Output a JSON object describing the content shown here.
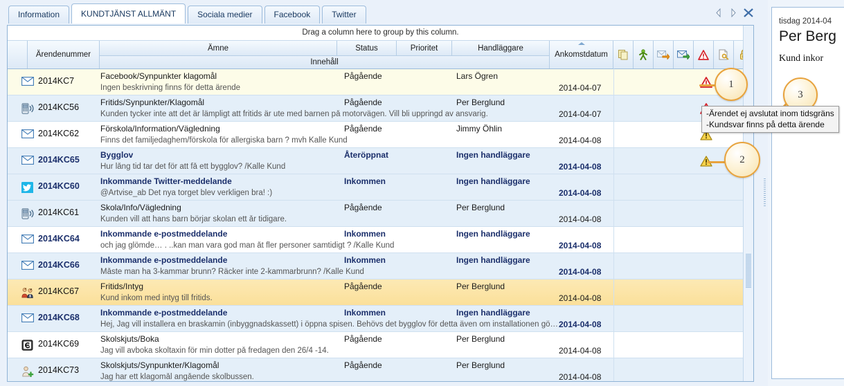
{
  "window": {
    "nav": {
      "prev_icon": "prev-arrow-icon",
      "next_icon": "next-arrow-icon",
      "close_icon": "close-x-icon"
    }
  },
  "tabs": [
    {
      "label": "Information",
      "active": false
    },
    {
      "label": "KUNDTJÄNST ALLMÄNT",
      "active": true
    },
    {
      "label": "Sociala medier",
      "active": false
    },
    {
      "label": "Facebook",
      "active": false
    },
    {
      "label": "Twitter",
      "active": false
    }
  ],
  "grid": {
    "group_hint": "Drag a column here to group by this column.",
    "columns": {
      "arendenummer": "Ärendenummer",
      "amne": "Ämne",
      "innehall": "Innehåll",
      "status": "Status",
      "prioritet": "Prioritet",
      "handlaggare": "Handläggare",
      "ankomstdatum": "Ankomstdatum"
    },
    "sort": {
      "column": "Ankomstdatum",
      "direction": "asc"
    },
    "header_icons": [
      "copy-documents-icon",
      "person-green-icon",
      "envelope-orange-arrow-icon",
      "envelope-green-arrow-icon",
      "red-warning-triangle-icon",
      "document-key-icon",
      "lock-icon"
    ],
    "rows": [
      {
        "channel_icon": "envelope-icon",
        "arendenummer": "2014KC7",
        "amne": "Facebook/Synpunkter klagomål",
        "innehall": "Ingen beskrivning finns för detta ärende",
        "status": "Pågående",
        "prioritet": "",
        "handlaggare": "Lars Ögren",
        "ankomstdatum": "2014-04-07",
        "warning": "red-warning-triangle-icon",
        "bold": false,
        "band": "cream"
      },
      {
        "channel_icon": "mobile-phone-icon",
        "arendenummer": "2014KC56",
        "amne": "Fritids/Synpunkter/Klagomål",
        "innehall": "Kunden tycker inte att det är lämpligt att fritids är ute med barnen på motorvägen. Vill bli uppringd av ansvarig.",
        "status": "Pågående",
        "prioritet": "",
        "handlaggare": "Per Berglund",
        "ankomstdatum": "2014-04-07",
        "warning": "red-warning-triangle-icon",
        "bold": false,
        "band": "odd"
      },
      {
        "channel_icon": "envelope-icon",
        "arendenummer": "2014KC62",
        "amne": "Förskola/Information/Vägledning",
        "innehall": "Finns det familjedaghem/förskola för allergiska barn ?    mvh    Kalle Kund",
        "status": "Pågående",
        "prioritet": "",
        "handlaggare": "Jimmy Öhlin",
        "ankomstdatum": "2014-04-08",
        "warning": "yellow-warning-triangle-icon",
        "bold": false,
        "band": "even"
      },
      {
        "channel_icon": "envelope-icon",
        "arendenummer": "2014KC65",
        "amne": "Bygglov",
        "innehall": "Hur lång tid tar det för att få ett bygglov?    /Kalle Kund",
        "status": "Återöppnat",
        "prioritet": "",
        "handlaggare": "Ingen handläggare",
        "ankomstdatum": "2014-04-08",
        "warning": "yellow-warning-triangle-icon",
        "bold": true,
        "band": "odd"
      },
      {
        "channel_icon": "twitter-icon",
        "arendenummer": "2014KC60",
        "amne": "Inkommande Twitter-meddelande",
        "innehall": "@Artvise_ab Det nya torget blev verkligen bra! :)",
        "status": "Inkommen",
        "prioritet": "",
        "handlaggare": "Ingen handläggare",
        "ankomstdatum": "2014-04-08",
        "warning": "",
        "bold": true,
        "band": "odd"
      },
      {
        "channel_icon": "mobile-phone-icon",
        "arendenummer": "2014KC61",
        "amne": "Skola/Info/Vägledning",
        "innehall": "Kunden vill att hans barn börjar skolan ett år tidigare.",
        "status": "Pågående",
        "prioritet": "",
        "handlaggare": "Per Berglund",
        "ankomstdatum": "2014-04-08",
        "warning": "",
        "bold": false,
        "band": "odd"
      },
      {
        "channel_icon": "envelope-icon",
        "arendenummer": "2014KC64",
        "amne": "Inkommande e-postmeddelande",
        "innehall": "och jag glömde… .  ..kan man vara god man åt fler personer samtidigt ?    /Kalle Kund",
        "status": "Inkommen",
        "prioritet": "",
        "handlaggare": "Ingen handläggare",
        "ankomstdatum": "2014-04-08",
        "warning": "",
        "bold": true,
        "band": "even"
      },
      {
        "channel_icon": "envelope-icon",
        "arendenummer": "2014KC66",
        "amne": "Inkommande e-postmeddelande",
        "innehall": "Måste man ha 3-kammar brunn? Räcker inte 2-kammarbrunn?        /Kalle Kund",
        "status": "Inkommen",
        "prioritet": "",
        "handlaggare": "Ingen handläggare",
        "ankomstdatum": "2014-04-08",
        "warning": "",
        "bold": true,
        "band": "odd"
      },
      {
        "channel_icon": "people-group-icon",
        "arendenummer": "2014KC67",
        "amne": "Fritids/Intyg",
        "innehall": "Kund inkom med intyg till fritids.",
        "status": "Pågående",
        "prioritet": "",
        "handlaggare": "Per Berglund",
        "ankomstdatum": "2014-04-08",
        "warning": "",
        "bold": false,
        "band": "amber"
      },
      {
        "channel_icon": "envelope-icon",
        "arendenummer": "2014KC68",
        "amne": "Inkommande e-postmeddelande",
        "innehall": "Hej,    Jag vill installera en braskamin (inbyggnadskassett) i öppna spisen. Behövs  det bygglov för detta även om installationen gö…",
        "status": "Inkommen",
        "prioritet": "",
        "handlaggare": "Ingen handläggare",
        "ankomstdatum": "2014-04-08",
        "warning": "",
        "bold": true,
        "band": "odd"
      },
      {
        "channel_icon": "e-badge-icon",
        "arendenummer": "2014KC69",
        "amne": "Skolskjuts/Boka",
        "innehall": "Jag vill avboka skoltaxin för min dotter på fredagen den 26/4 -14.",
        "status": "Pågående",
        "prioritet": "",
        "handlaggare": "Per Berglund",
        "ankomstdatum": "2014-04-08",
        "warning": "",
        "bold": false,
        "band": "even"
      },
      {
        "channel_icon": "add-person-icon",
        "arendenummer": "2014KC73",
        "amne": "Skolskjuts/Synpunkter/Klagomål",
        "innehall": "Jag har ett klagomål angående skolbussen.",
        "status": "Pågående",
        "prioritet": "",
        "handlaggare": "Per Berglund",
        "ankomstdatum": "2014-04-08",
        "warning": "",
        "bold": false,
        "band": "odd"
      }
    ]
  },
  "tooltip": {
    "line1": "-Ärendet ej avslutat inom tidsgräns",
    "line2": "-Kundsvar finns på detta ärende"
  },
  "callouts": [
    {
      "number": "1"
    },
    {
      "number": "2"
    },
    {
      "number": "3"
    }
  ],
  "detail_panel": {
    "date": "tisdag 2014-04",
    "name": "Per Berg",
    "subtitle": "Kund inkor"
  },
  "colors": {
    "accent_blue": "#1b2f6b",
    "callout_gold": "#e8a33d",
    "row_highlight_amber": "#fbe09a",
    "row_highlight_cream": "#fdfce8",
    "grid_band": "#e4eff9"
  }
}
